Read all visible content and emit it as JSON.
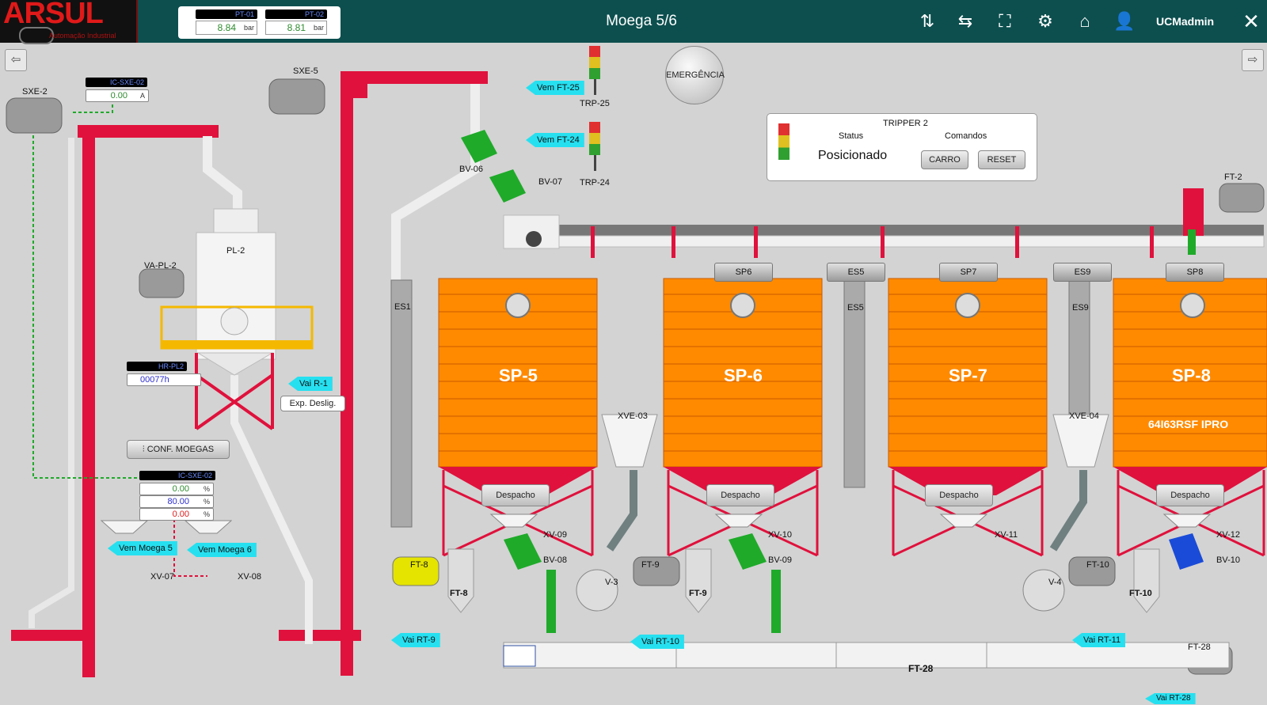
{
  "header": {
    "title": "Moega 5/6",
    "user": "UCMadmin",
    "logo_text": "ARSUL",
    "logo_subtitle": "Automação Industrial",
    "pressure": [
      {
        "tag": "PT-01",
        "value": "8.84",
        "unit": "bar"
      },
      {
        "tag": "PT-02",
        "value": "8.81",
        "unit": "bar"
      }
    ],
    "icons": [
      "sort-icon",
      "route-icon",
      "fullscreen-icon",
      "settings-icon",
      "home-icon",
      "user-icon",
      "close-icon"
    ]
  },
  "nav": {
    "back": "back-arrow-icon",
    "forward": "forward-arrow-icon"
  },
  "emergency_label": "EMERGÊNCIA",
  "tripper": {
    "title": "TRIPPER 2",
    "status_label": "Status",
    "commands_label": "Comandos",
    "status_value": "Posicionado",
    "carro_label": "CARRO",
    "reset_label": "RESET"
  },
  "left": {
    "sxe2": "SXE-2",
    "sxe5": "SXE-5",
    "ic_sxe02_top": {
      "tag": "IC-SXE-02",
      "value": "0.00",
      "unit": "A"
    },
    "pl2": "PL-2",
    "vapl2": "VA-PL-2",
    "hr_pl2": {
      "tag": "HR-PL2",
      "value": "00077h"
    },
    "vai_r1": "Vai R-1",
    "exp_deslig": "Exp. Deslig.",
    "conf_moegas": "CONF. MOEGAS",
    "ic_sxe02_bottom": {
      "tag": "IC-SXE-02",
      "values": [
        "0.00",
        "80.00",
        "0.00"
      ],
      "unit": "%"
    },
    "vem_moega5": "Vem Moega 5",
    "vem_moega6": "Vem Moega 6",
    "xv07": "XV-07",
    "xv08": "XV-08"
  },
  "valves": {
    "bv06": "BV-06",
    "bv07": "BV-07",
    "bv08": "BV-08",
    "bv09": "BV-09",
    "bv10": "BV-10"
  },
  "arrows": {
    "vem_ft25": "Vem FT-25",
    "vem_ft24": "Vem FT-24",
    "vai_rt9": "Vai RT-9",
    "vai_rt10": "Vai RT-10",
    "vai_rt11": "Vai RT-11",
    "vai_rt28": "Vai RT-28"
  },
  "towers": {
    "trp25": "TRP-25",
    "trp24": "TRP-24"
  },
  "silos": [
    {
      "name": "SP-5",
      "header": "",
      "product": "",
      "dispatch": "Despacho",
      "xv": "XV-09"
    },
    {
      "name": "SP-6",
      "header": "SP6",
      "product": "",
      "dispatch": "Despacho",
      "xv": "XV-10"
    },
    {
      "name": "SP-7",
      "header": "SP7",
      "product": "",
      "dispatch": "Despacho",
      "xv": "XV-11"
    },
    {
      "name": "SP-8",
      "header": "SP8",
      "product": "64I63RSF IPRO",
      "dispatch": "Despacho",
      "xv": "XV-12"
    }
  ],
  "elevators": {
    "es1": "ES1",
    "es5_top": "ES5",
    "es5": "ES5",
    "es9_top": "ES9",
    "es9": "ES9"
  },
  "misc": {
    "xve03": "XVE-03",
    "xve04": "XVE-04",
    "v3": "V-3",
    "v4": "V-4",
    "ft2": "FT-2",
    "ft28": "FT-28",
    "ft28_label": "FT-28"
  },
  "filters": [
    {
      "label": "FT-8",
      "name": "FT-8"
    },
    {
      "label": "FT-9",
      "name": "FT-9"
    },
    {
      "label": "FT-10",
      "name": "FT-10"
    }
  ],
  "colors": {
    "header": "#0d4f4f",
    "silo_orange": "#ff8a00",
    "structure_red": "#e0113c",
    "valve_green": "#1faa2a",
    "arrow_cyan": "#26e0f0"
  }
}
